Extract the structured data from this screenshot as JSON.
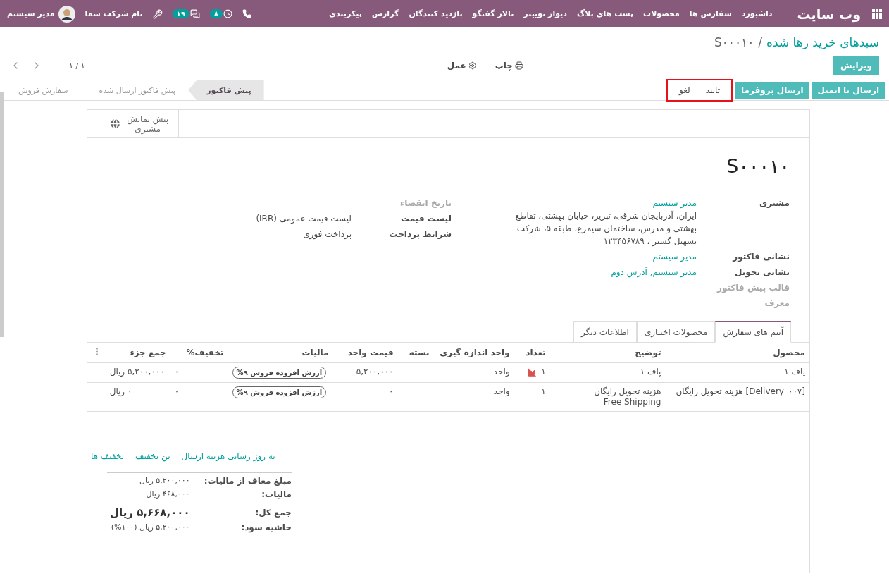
{
  "navbar": {
    "app_title": "وب سایت",
    "menu": [
      "داشبورد",
      "سفارش ها",
      "محصولات",
      "پست های بلاگ",
      "دیوار توییتر",
      "تالار گفتگو",
      "بازدید کنندگان",
      "گزارش",
      "پیکربندی"
    ],
    "activity_count": "۸",
    "message_count": "۱۹",
    "company": "نام شرکت شما",
    "user": "مدیر سیستم"
  },
  "breadcrumb_separator": "/",
  "breadcrumb": [
    {
      "label": "سبدهای خرید رها شده",
      "kind": "link"
    },
    {
      "label": "S۰۰۰۱۰",
      "kind": "current"
    }
  ],
  "edit_button": "ویرایش",
  "actions": [
    {
      "label": "چاپ",
      "kind": "print"
    },
    {
      "label": "عمل",
      "kind": "action"
    }
  ],
  "pager": "۱ / ۱",
  "statusbar": {
    "buttons": [
      {
        "label": "ارسال با ایمیل",
        "kind": "primary",
        "highlighted": false
      },
      {
        "label": "ارسال پروفرما",
        "kind": "primary",
        "highlighted": false
      },
      {
        "label": "تایید",
        "kind": "plain",
        "highlighted": true
      },
      {
        "label": "لغو",
        "kind": "plain",
        "highlighted": true
      }
    ],
    "stages": [
      {
        "label": "پیش فاکتور",
        "selected": true
      },
      {
        "label": "پیش فاکتور ارسال شده",
        "selected": false
      },
      {
        "label": "سفارش فروش",
        "selected": false
      }
    ]
  },
  "button_box": [
    "پیش نمایش",
    "مشتری"
  ],
  "title": "S۰۰۰۱۰",
  "group_main": [
    {
      "label": "مشتری",
      "kind": "strong",
      "values": [
        {
          "text": "مدیر سیستم",
          "kind": "link"
        },
        {
          "text": "ایران، آذربایجان شرقی، تبریز، خیابان بهشتی، تقاطع بهشتی و مدرس، ساختمان سیمرغ، طبقه ۵، شرکت تسهیل گستر ، ۱۲۳۴۵۶۷۸۹",
          "kind": "text"
        }
      ]
    },
    {
      "label": "نشانی فاکتور",
      "kind": "strong",
      "values": [
        {
          "text": "مدیر سیستم",
          "kind": "link"
        }
      ]
    },
    {
      "label": "نشانی تحویل",
      "kind": "strong",
      "values": [
        {
          "text": "مدیر سیستم, آدرس دوم",
          "kind": "link"
        }
      ]
    },
    {
      "label": "قالب پیش فاکتور",
      "kind": "muted"
    },
    {
      "label": "معرف",
      "kind": "muted"
    }
  ],
  "group_side": [
    {
      "label": "تاریخ انقضاء",
      "kind": "muted"
    },
    {
      "label": "لیست قیمت",
      "kind": "strong",
      "values": [
        {
          "text": "لیست قیمت عمومی (IRR)",
          "kind": "text"
        }
      ]
    },
    {
      "label": "شرایط پرداخت",
      "kind": "strong",
      "values": [
        {
          "text": "پرداخت فوری",
          "kind": "text"
        }
      ]
    }
  ],
  "tabs": [
    {
      "label": "آیتم های سفارش",
      "selected": true
    },
    {
      "label": "محصولات اختیاری",
      "selected": false
    },
    {
      "label": "اطلاعات دیگر",
      "selected": false
    }
  ],
  "table": {
    "columns": [
      "محصول",
      "توضیح",
      "تعداد",
      "واحد اندازه گیری",
      "بسته",
      "قیمت واحد",
      "مالیات",
      "تخفیف%",
      "جمع جزء"
    ],
    "rows": [
      {
        "product": "پاف ۱",
        "description": [
          "پاف ۱"
        ],
        "quantity": "۱",
        "forecast_warning": true,
        "uom": "واحد",
        "package": "",
        "unit_price": "۵,۲۰۰,۰۰۰",
        "tax": "ارزش افزوده فروش ۹%",
        "discount": "۰",
        "subtotal": "۵,۲۰۰,۰۰۰ ریال"
      },
      {
        "product": "[Delivery_۰۰۷] هزینه تحویل رایگان",
        "description": [
          "هزینه تحویل رایگان",
          "Free Shipping"
        ],
        "quantity": "۱",
        "forecast_warning": false,
        "uom": "واحد",
        "package": "",
        "unit_price": "۰",
        "tax": "ارزش افزوده فروش ۹%",
        "discount": "۰",
        "subtotal": "۰ ریال"
      }
    ]
  },
  "footer_links": [
    "به روز رسانی هزینه ارسال",
    "بن تخفیف",
    "تخفیف ها"
  ],
  "totals": [
    {
      "label": "مبلغ معاف از مالیات:",
      "value": "۵,۲۰۰,۰۰۰ ریال",
      "kind": "normal"
    },
    {
      "label": "مالیات:",
      "value": "۴۶۸,۰۰۰ ریال",
      "kind": "normal"
    },
    {
      "label": "جمع کل:",
      "value": "۵,۶۶۸,۰۰۰ ریال",
      "kind": "total"
    },
    {
      "label": "حاشیه سود:",
      "value": "۵,۲۰۰,۰۰۰ ریال (۱۰۰%)",
      "kind": "normal"
    }
  ]
}
